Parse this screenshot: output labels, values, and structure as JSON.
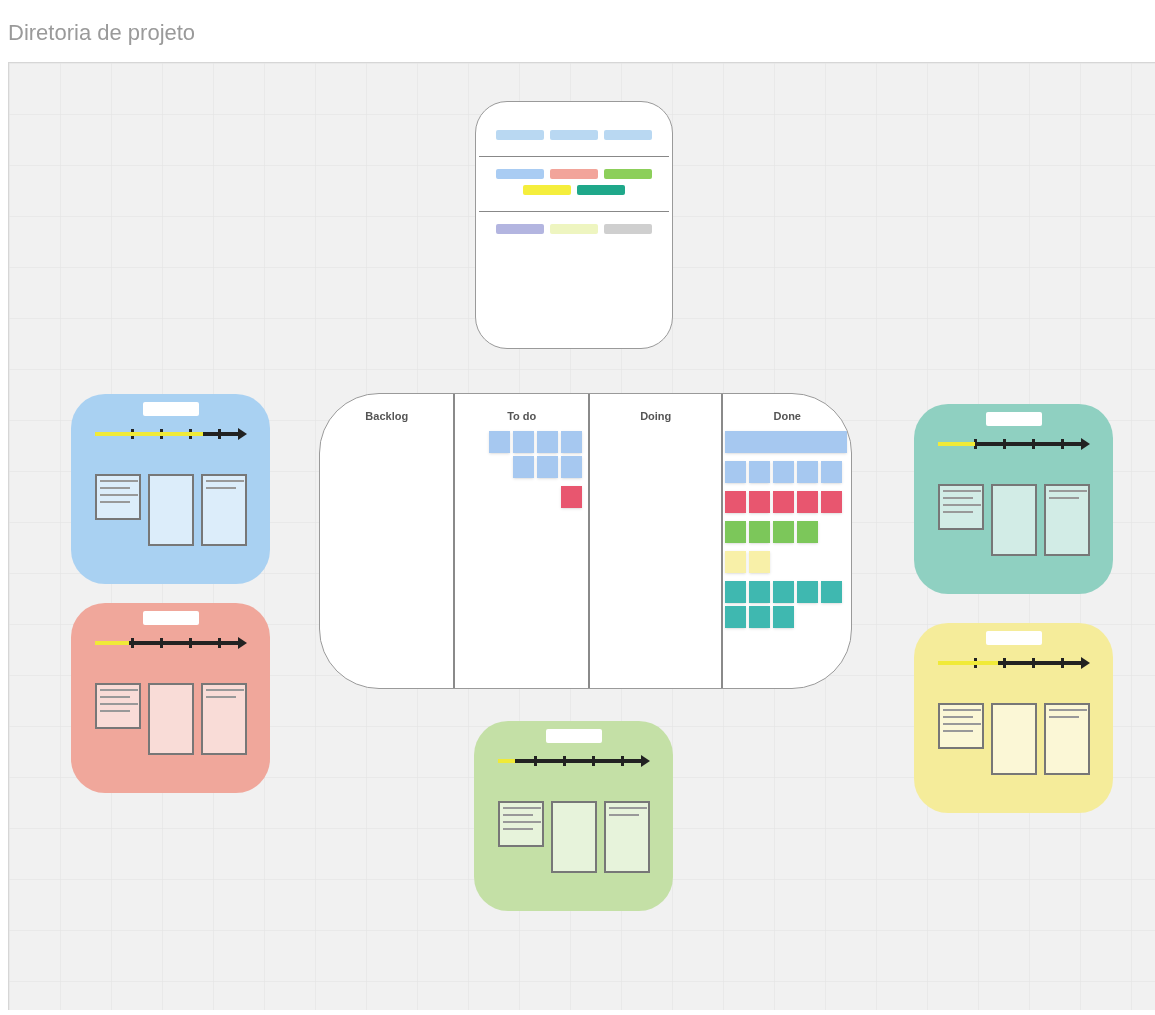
{
  "board": {
    "title": "Diretoria de projeto"
  },
  "legend_card": {
    "rows": [
      {
        "tags": [
          {
            "color": "#b9d8f2"
          },
          {
            "color": "#b9d8f2"
          },
          {
            "color": "#b9d8f2"
          }
        ]
      },
      {
        "tags": [
          {
            "color": "#a9ccf3"
          },
          {
            "color": "#f2a49a"
          },
          {
            "color": "#8ccf5a"
          },
          {
            "color": "#f5ee3c"
          },
          {
            "color": "#1fa88a"
          }
        ]
      },
      {
        "tags": [
          {
            "color": "#b3b5e0"
          },
          {
            "color": "#eef5c0"
          },
          {
            "color": "#cfcfcf"
          }
        ]
      }
    ]
  },
  "kanban": {
    "columns": [
      {
        "title": "Backlog"
      },
      {
        "title": "To do",
        "groups": [
          {
            "notes": [
              {
                "kind": "sticky",
                "color": "#a6c8f0"
              },
              {
                "kind": "sticky",
                "color": "#a6c8f0"
              },
              {
                "kind": "sticky",
                "color": "#a6c8f0"
              },
              {
                "kind": "sticky",
                "color": "#a6c8f0"
              },
              {
                "kind": "sticky",
                "color": "#a6c8f0"
              },
              {
                "kind": "sticky",
                "color": "#a6c8f0"
              },
              {
                "kind": "sticky",
                "color": "#a6c8f0"
              }
            ]
          },
          {
            "notes": [
              {
                "kind": "sticky",
                "color": "#e8566f"
              }
            ]
          }
        ]
      },
      {
        "title": "Doing"
      },
      {
        "title": "Done",
        "groups": [
          {
            "notes": [
              {
                "kind": "wide",
                "color": "#a6c8f0"
              }
            ]
          },
          {
            "notes": [
              {
                "kind": "sticky",
                "color": "#a6c8f0"
              },
              {
                "kind": "sticky",
                "color": "#a6c8f0"
              },
              {
                "kind": "sticky",
                "color": "#a6c8f0"
              },
              {
                "kind": "sticky",
                "color": "#a6c8f0"
              },
              {
                "kind": "sticky",
                "color": "#a6c8f0"
              }
            ]
          },
          {
            "notes": [
              {
                "kind": "sticky",
                "color": "#e8566f"
              },
              {
                "kind": "sticky",
                "color": "#e8566f"
              },
              {
                "kind": "sticky",
                "color": "#e8566f"
              },
              {
                "kind": "sticky",
                "color": "#e8566f"
              },
              {
                "kind": "sticky",
                "color": "#e8566f"
              }
            ]
          },
          {
            "notes": [
              {
                "kind": "sticky",
                "color": "#7cc75a"
              },
              {
                "kind": "sticky",
                "color": "#7cc75a"
              },
              {
                "kind": "sticky",
                "color": "#7cc75a"
              },
              {
                "kind": "sticky",
                "color": "#7cc75a"
              }
            ]
          },
          {
            "notes": [
              {
                "kind": "sticky",
                "color": "#f8f0a8"
              },
              {
                "kind": "sticky",
                "color": "#f8f0a8"
              }
            ]
          },
          {
            "notes": [
              {
                "kind": "sticky",
                "color": "#3fb8b0"
              },
              {
                "kind": "sticky",
                "color": "#3fb8b0"
              },
              {
                "kind": "sticky",
                "color": "#3fb8b0"
              },
              {
                "kind": "sticky",
                "color": "#3fb8b0"
              },
              {
                "kind": "sticky",
                "color": "#3fb8b0"
              },
              {
                "kind": "sticky",
                "color": "#3fb8b0"
              },
              {
                "kind": "sticky",
                "color": "#3fb8b0"
              },
              {
                "kind": "sticky",
                "color": "#3fb8b0"
              }
            ]
          }
        ]
      }
    ]
  },
  "timeline_cards": [
    {
      "color": "#a9d1f2",
      "level": 0.76
    },
    {
      "color": "#f0a79b",
      "level": 0.24
    },
    {
      "color": "#c4e0a6",
      "level": 0.12
    },
    {
      "color": "#8fd0c1",
      "level": 0.26
    },
    {
      "color": "#f5ec9a",
      "level": 0.42
    }
  ]
}
